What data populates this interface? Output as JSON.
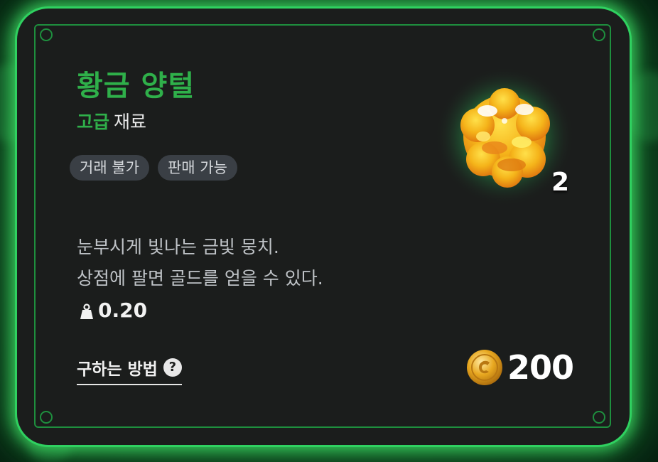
{
  "item": {
    "name": "황금 양털",
    "grade": "고급",
    "category": "재료",
    "tags": [
      "거래 불가",
      "판매 가능"
    ],
    "description_lines": [
      "눈부시게 빛나는 금빛 뭉치.",
      "상점에 팔면 골드를 얻을 수 있다."
    ],
    "weight": "0.20",
    "count": "2",
    "price": "200",
    "how_to_obtain": "구하는 방법",
    "help_glyph": "?",
    "icon": "golden-wool-icon"
  },
  "colors": {
    "accent_green": "#2fb04a",
    "glow_green": "#2fd160",
    "panel": "#1b1d1c",
    "tag_bg": "#3a3f45",
    "gold": "#e8a820"
  }
}
